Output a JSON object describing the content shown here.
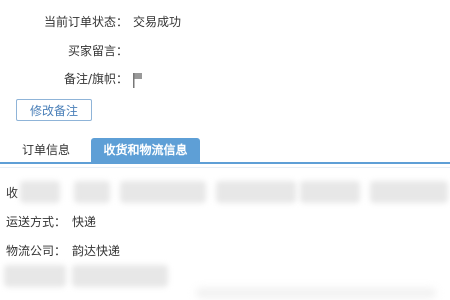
{
  "order": {
    "status_label": "当前订单状态：",
    "status_value": "交易成功",
    "buyer_message_label": "买家留言：",
    "buyer_message_value": "",
    "note_flag_label": "备注/旗帜：",
    "modify_note_button": "修改备注"
  },
  "tabs": [
    {
      "label": "订单信息",
      "active": false
    },
    {
      "label": "收货和物流信息",
      "active": true
    }
  ],
  "shipping": {
    "recipient_label": "收",
    "delivery_method_label": "运送方式：",
    "delivery_method_value": "快递",
    "logistics_company_label": "物流公司：",
    "logistics_company_value": "韵达快递"
  },
  "colors": {
    "accent": "#5e9fd6",
    "button_border": "#8fb4d8",
    "button_text": "#4a7fb8",
    "text": "#333333"
  },
  "icons": {
    "flag": "flag-icon"
  }
}
